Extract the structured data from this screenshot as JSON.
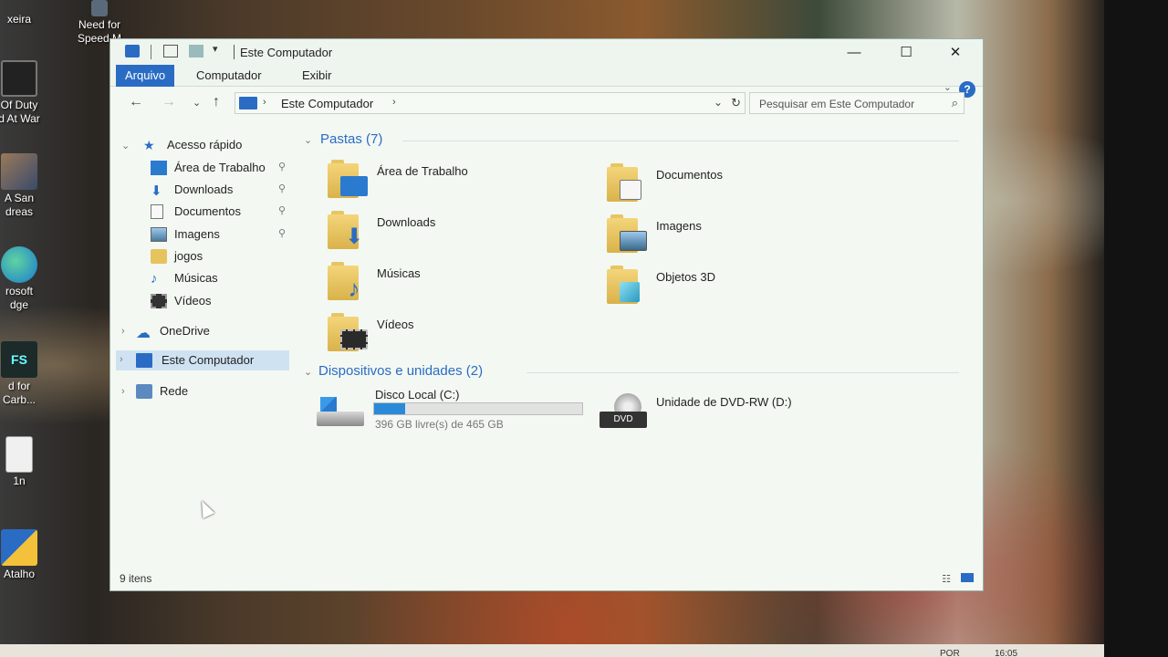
{
  "desktop": {
    "icons": [
      {
        "label": "xeira"
      },
      {
        "label": "Need for\nSpeed M"
      },
      {
        "label": "Of Duty\nd At War"
      },
      {
        "label": "A San\ndreas"
      },
      {
        "label": "rosoft\ndge"
      },
      {
        "label": "d for\nCarb..."
      },
      {
        "label": "1n"
      },
      {
        "label": "Atalho"
      }
    ]
  },
  "taskbar": {
    "lang": "POR",
    "time": "16:05"
  },
  "window": {
    "title": "Este Computador",
    "ribbon_tabs": [
      {
        "label": "Arquivo",
        "active": true
      },
      {
        "label": "Computador",
        "active": false
      },
      {
        "label": "Exibir",
        "active": false
      }
    ],
    "help_label": "?",
    "address": "Este Computador",
    "search_placeholder": "Pesquisar em Este Computador",
    "nav": {
      "quick_access": "Acesso rápido",
      "quick_items": [
        {
          "label": "Área de Trabalho",
          "icon": "desktop-icon",
          "pinned": true
        },
        {
          "label": "Downloads",
          "icon": "download-arrow-icon",
          "pinned": true
        },
        {
          "label": "Documentos",
          "icon": "document-icon",
          "pinned": true
        },
        {
          "label": "Imagens",
          "icon": "picture-icon",
          "pinned": true
        },
        {
          "label": "jogos",
          "icon": "folder-icon",
          "pinned": false
        },
        {
          "label": "Músicas",
          "icon": "music-note-icon",
          "pinned": false
        },
        {
          "label": "Vídeos",
          "icon": "film-icon",
          "pinned": false
        }
      ],
      "onedrive": "OneDrive",
      "this_pc": "Este Computador",
      "network": "Rede"
    },
    "folders_header": "Pastas (7)",
    "folders": [
      {
        "label": "Área de Trabalho",
        "badge": "desktop"
      },
      {
        "label": "Documentos",
        "badge": "document"
      },
      {
        "label": "Downloads",
        "badge": "download"
      },
      {
        "label": "Imagens",
        "badge": "picture"
      },
      {
        "label": "Músicas",
        "badge": "music"
      },
      {
        "label": "Objetos 3D",
        "badge": "cube"
      },
      {
        "label": "Vídeos",
        "badge": "film"
      }
    ],
    "devices_header": "Dispositivos e unidades (2)",
    "drives": [
      {
        "label": "Disco Local (C:)",
        "free_text": "396 GB livre(s) de 465 GB",
        "used_fraction": 0.148
      },
      {
        "label": "Unidade de DVD-RW (D:)",
        "badge": "DVD"
      }
    ],
    "status": "9 itens",
    "colors": {
      "accent": "#2a6cc4",
      "window_bg": "#f3f8f2",
      "bar_fill": "#2a8ad8"
    }
  }
}
